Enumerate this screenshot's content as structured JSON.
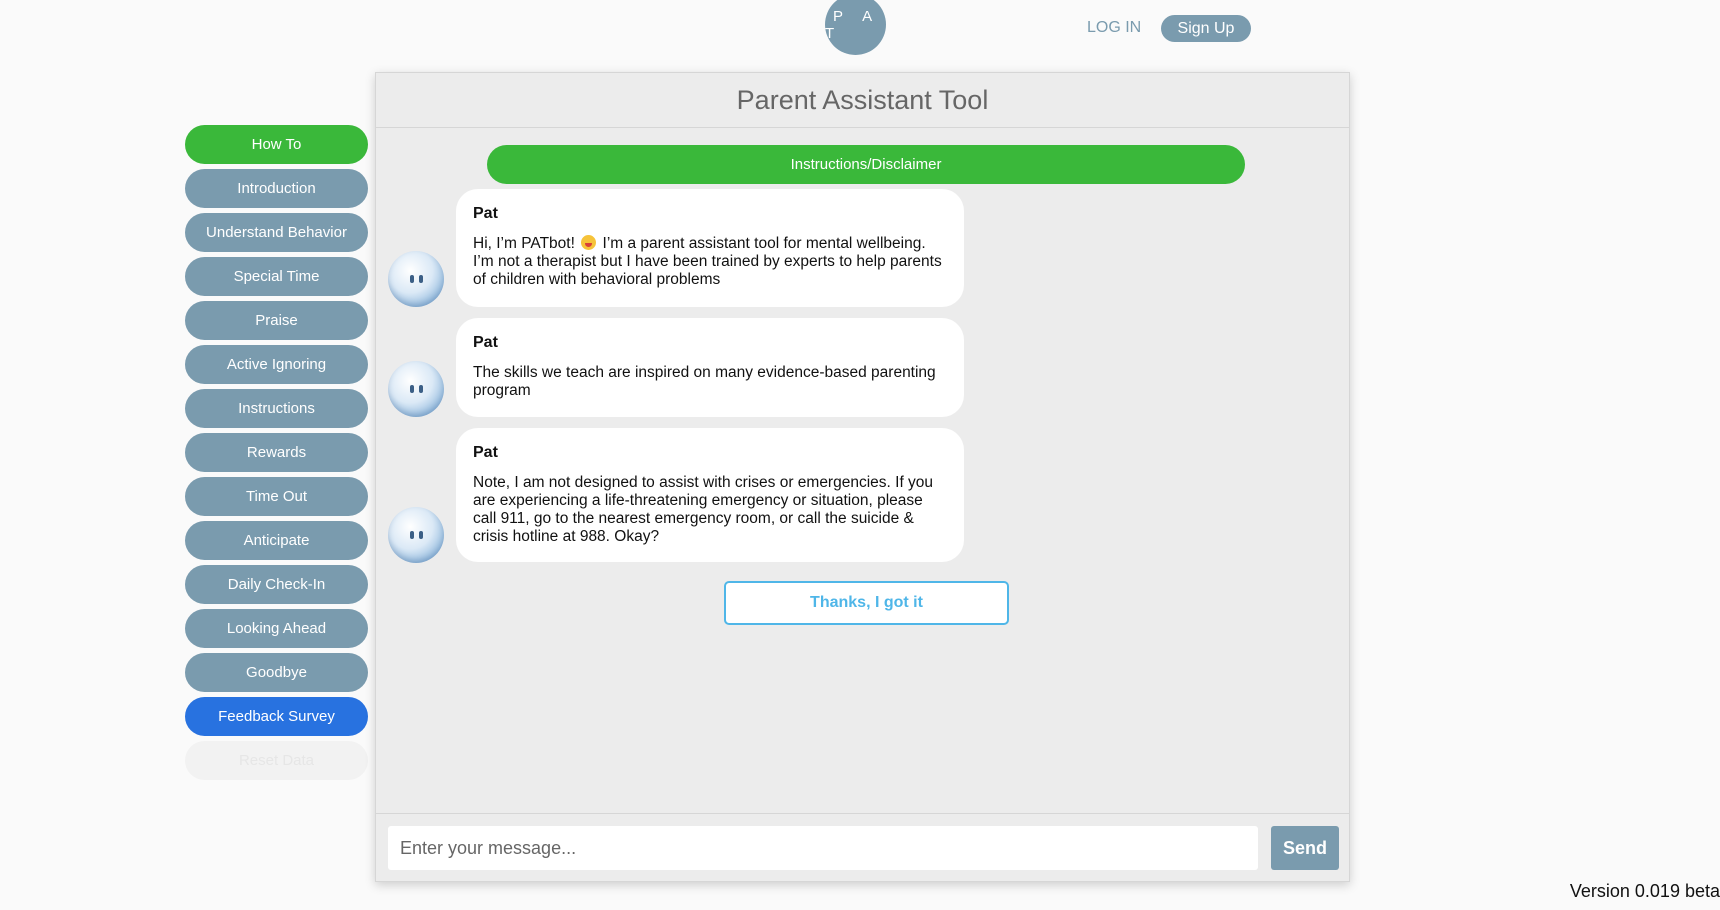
{
  "header": {
    "logo_text": "PAT",
    "login_label": "LOG IN",
    "signup_label": "Sign Up"
  },
  "sidebar": {
    "items": [
      {
        "label": "How To",
        "color": "#3ab83a"
      },
      {
        "label": "Introduction",
        "color": "#7a9bae"
      },
      {
        "label": "Understand Behavior",
        "color": "#7a9bae"
      },
      {
        "label": "Special Time",
        "color": "#7a9bae"
      },
      {
        "label": "Praise",
        "color": "#7a9bae"
      },
      {
        "label": "Active Ignoring",
        "color": "#7a9bae"
      },
      {
        "label": "Instructions",
        "color": "#7a9bae"
      },
      {
        "label": "Rewards",
        "color": "#7a9bae"
      },
      {
        "label": "Time Out",
        "color": "#7a9bae"
      },
      {
        "label": "Anticipate",
        "color": "#7a9bae"
      },
      {
        "label": "Daily Check-In",
        "color": "#7a9bae"
      },
      {
        "label": "Looking Ahead",
        "color": "#7a9bae"
      },
      {
        "label": "Goodbye",
        "color": "#7a9bae"
      },
      {
        "label": "Feedback Survey",
        "color": "#2872e0"
      },
      {
        "label": "Reset Data",
        "color": "#f2f2f2"
      }
    ]
  },
  "chat": {
    "title": "Parent Assistant Tool",
    "disclaimer_label": "Instructions/Disclaimer",
    "messages": [
      {
        "sender": "Pat",
        "avatar_icon": "robot-avatar-icon",
        "text_before_emoji": "Hi, I’m PATbot! ",
        "emoji": "grinning-face-emoji",
        "text_after_emoji": " I’m a parent assistant tool for mental wellbeing. I’m not a therapist but I have been trained by experts to help parents of children with behavioral problems"
      },
      {
        "sender": "Pat",
        "avatar_icon": "robot-avatar-icon",
        "text": "The skills we teach are inspired on many evidence-based parenting program"
      },
      {
        "sender": "Pat",
        "avatar_icon": "robot-avatar-icon",
        "text": "Note, I am not designed to assist with crises or emergencies. If you are experiencing a life-threatening emergency or situation, please call 911, go to the nearest emergency room, or call the suicide & crisis hotline at 988. Okay?"
      }
    ],
    "quick_reply_label": "Thanks, I got it",
    "input_placeholder": "Enter your message...",
    "input_value": "",
    "send_label": "Send"
  },
  "footer": {
    "version": "Version 0.019 beta"
  },
  "colors": {
    "accent_green": "#3ab83a",
    "accent_slate": "#7a9bae",
    "accent_blue": "#2872e0",
    "quick_reply_border": "#4fb6e8"
  }
}
